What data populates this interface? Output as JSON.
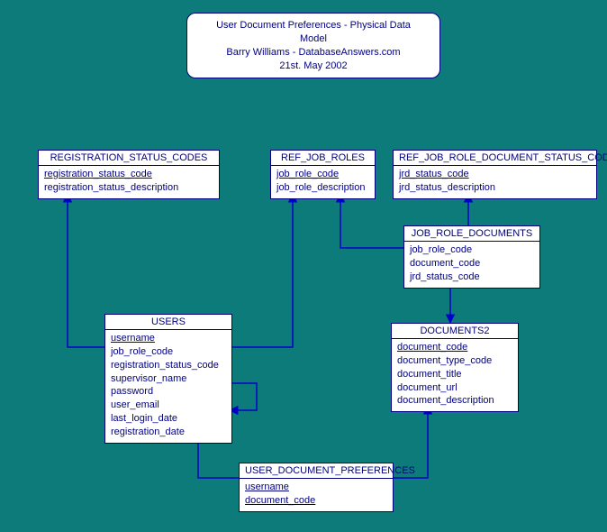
{
  "title": {
    "line1": "User Document Preferences - Physical Data Model",
    "line2": "Barry Williams - DatabaseAnswers.com",
    "line3": "21st. May 2002"
  },
  "entities": {
    "reg_status_codes": {
      "name": "REGISTRATION_STATUS_CODES",
      "cols": {
        "c0": "registration_status_code",
        "c1": "registration_status_description"
      }
    },
    "ref_job_roles": {
      "name": "REF_JOB_ROLES",
      "cols": {
        "c0": "job_role_code",
        "c1": "job_role_description"
      }
    },
    "ref_jrd_status_code": {
      "name": "REF_JOB_ROLE_DOCUMENT_STATUS_CODE",
      "cols": {
        "c0": "jrd_status_code",
        "c1": "jrd_status_description"
      }
    },
    "job_role_documents": {
      "name": "JOB_ROLE_DOCUMENTS",
      "cols": {
        "c0": "job_role_code",
        "c1": "document_code",
        "c2": "jrd_status_code"
      }
    },
    "users": {
      "name": "USERS",
      "cols": {
        "c0": "username",
        "c1": "job_role_code",
        "c2": "registration_status_code",
        "c3": "supervisor_name",
        "c4": "password",
        "c5": "user_email",
        "c6": "last_login_date",
        "c7": "registration_date"
      }
    },
    "documents2": {
      "name": "DOCUMENTS2",
      "cols": {
        "c0": "document_code",
        "c1": "document_type_code",
        "c2": "document_title",
        "c3": "document_url",
        "c4": "document_description"
      }
    },
    "user_document_preferences": {
      "name": "USER_DOCUMENT_PREFERENCES",
      "cols": {
        "c0": "username",
        "c1": "document_code"
      }
    }
  }
}
